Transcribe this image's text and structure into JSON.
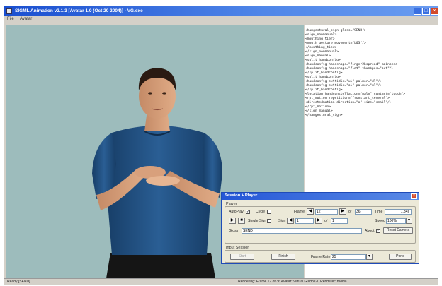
{
  "window": {
    "title": "SIGML Animation v2.1.3 [Avatar 1.0 (Oct 20 2004)] - VG.exe",
    "menu": [
      "File",
      "Avatar"
    ]
  },
  "xml_lines": [
    "<hamgestural_sign gloss=\"SEND\">",
    "  <sign_nonmanual>",
    "    <mouthing_tier>",
    "      <mouth_gesture movement=\"L03\"/>",
    "    </mouthing_tier>",
    "  </sign_nonmanual>",
    "  <sign_manual>",
    "    <split_handconfig>",
    "      <handconfig handshape=\"finger2bspread\" mainbend",
    "      <handconfig handshape=\"flat\" thumbpos=\"out\"/>",
    "    </split_handconfig>",
    "    <split_handconfig>",
    "      <handconfig extfidir=\"ul\" palmor=\"dl\"/>",
    "      <handconfig extfidir=\"ol\" palmor=\"ul\"/>",
    "    </split_handconfig>",
    "    <location_handconstellation=\"palm\" contact=\"touch\">",
    "    <rpt_motion repetition=\"fromstart_several\">",
    "      <directedmotion direction=\"o\" size=\"small\"/>",
    "    </rpt_motion>",
    "  </sign_manual>",
    "</hamgestural_sign>"
  ],
  "status": {
    "left": "Ready  [SEND]",
    "right": "Rendering: Frame 12 of 36   Avatar: Virtual Guido   GL Renderer: nVidia"
  },
  "dialog": {
    "title": "Session + Player",
    "player_group_label": "Player",
    "autoplay_label": "AutoPlay",
    "autoplay_checked": true,
    "cycle_label": "Cycle",
    "cycle_checked": false,
    "frame_label": "Frame",
    "frame_value": "12",
    "of_label": "of",
    "frame_total": "36",
    "time_label": "Time",
    "time_value": "1.84s",
    "single_sign_label": "Single Sign",
    "single_sign_checked": false,
    "sign_label": "Sign",
    "sign_value": "1",
    "sign_of_label": "of",
    "sign_total": "1",
    "speed_label": "Speed",
    "speed_value": "100%",
    "gloss_label": "Gloss",
    "gloss_value": "SEND",
    "about_label": "About",
    "about_checked": true,
    "reset_camera_label": "Reset Camera",
    "input_group_label": "Input Session",
    "start_label": "Start",
    "finish_label": "Finish",
    "frame_rate_label": "Frame Rate",
    "frame_rate_value": "25",
    "ports_label": "Ports",
    "play_icon": "play-icon",
    "stop_icon": "stop-icon"
  },
  "colors": {
    "viewport_bg": "#9dbcbc",
    "titlebar": "#1a4fd0",
    "shirt": "#1f4f80"
  }
}
